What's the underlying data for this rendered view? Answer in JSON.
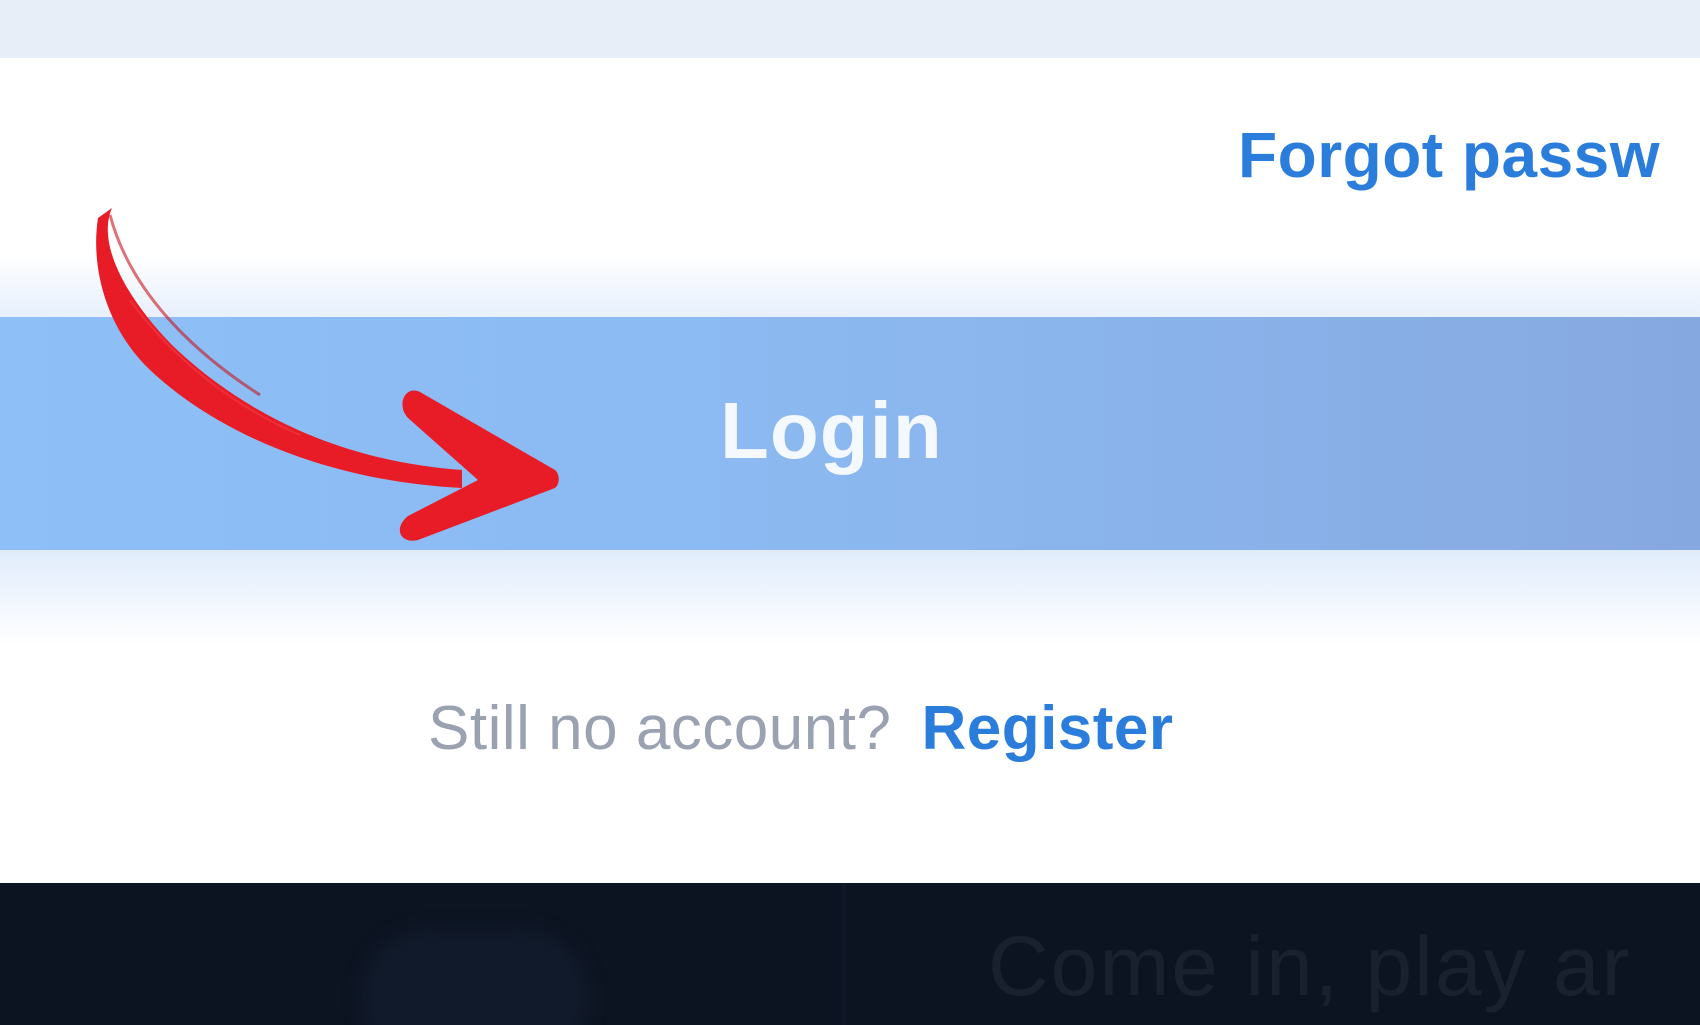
{
  "auth_form": {
    "forgot_password_label": "Forgot passw",
    "login_button_label": "Login",
    "register_prompt": "Still no account?",
    "register_link_label": "Register"
  },
  "footer": {
    "tagline": "Come in, play ar"
  },
  "annotation": {
    "arrow_icon": "red-curved-arrow-icon",
    "arrow_color": "#e81c27"
  },
  "colors": {
    "link_blue": "#2b7ddc",
    "button_gradient_start": "#8ebff7",
    "button_gradient_end": "#86a8e0",
    "footer_background": "#0c1422"
  }
}
